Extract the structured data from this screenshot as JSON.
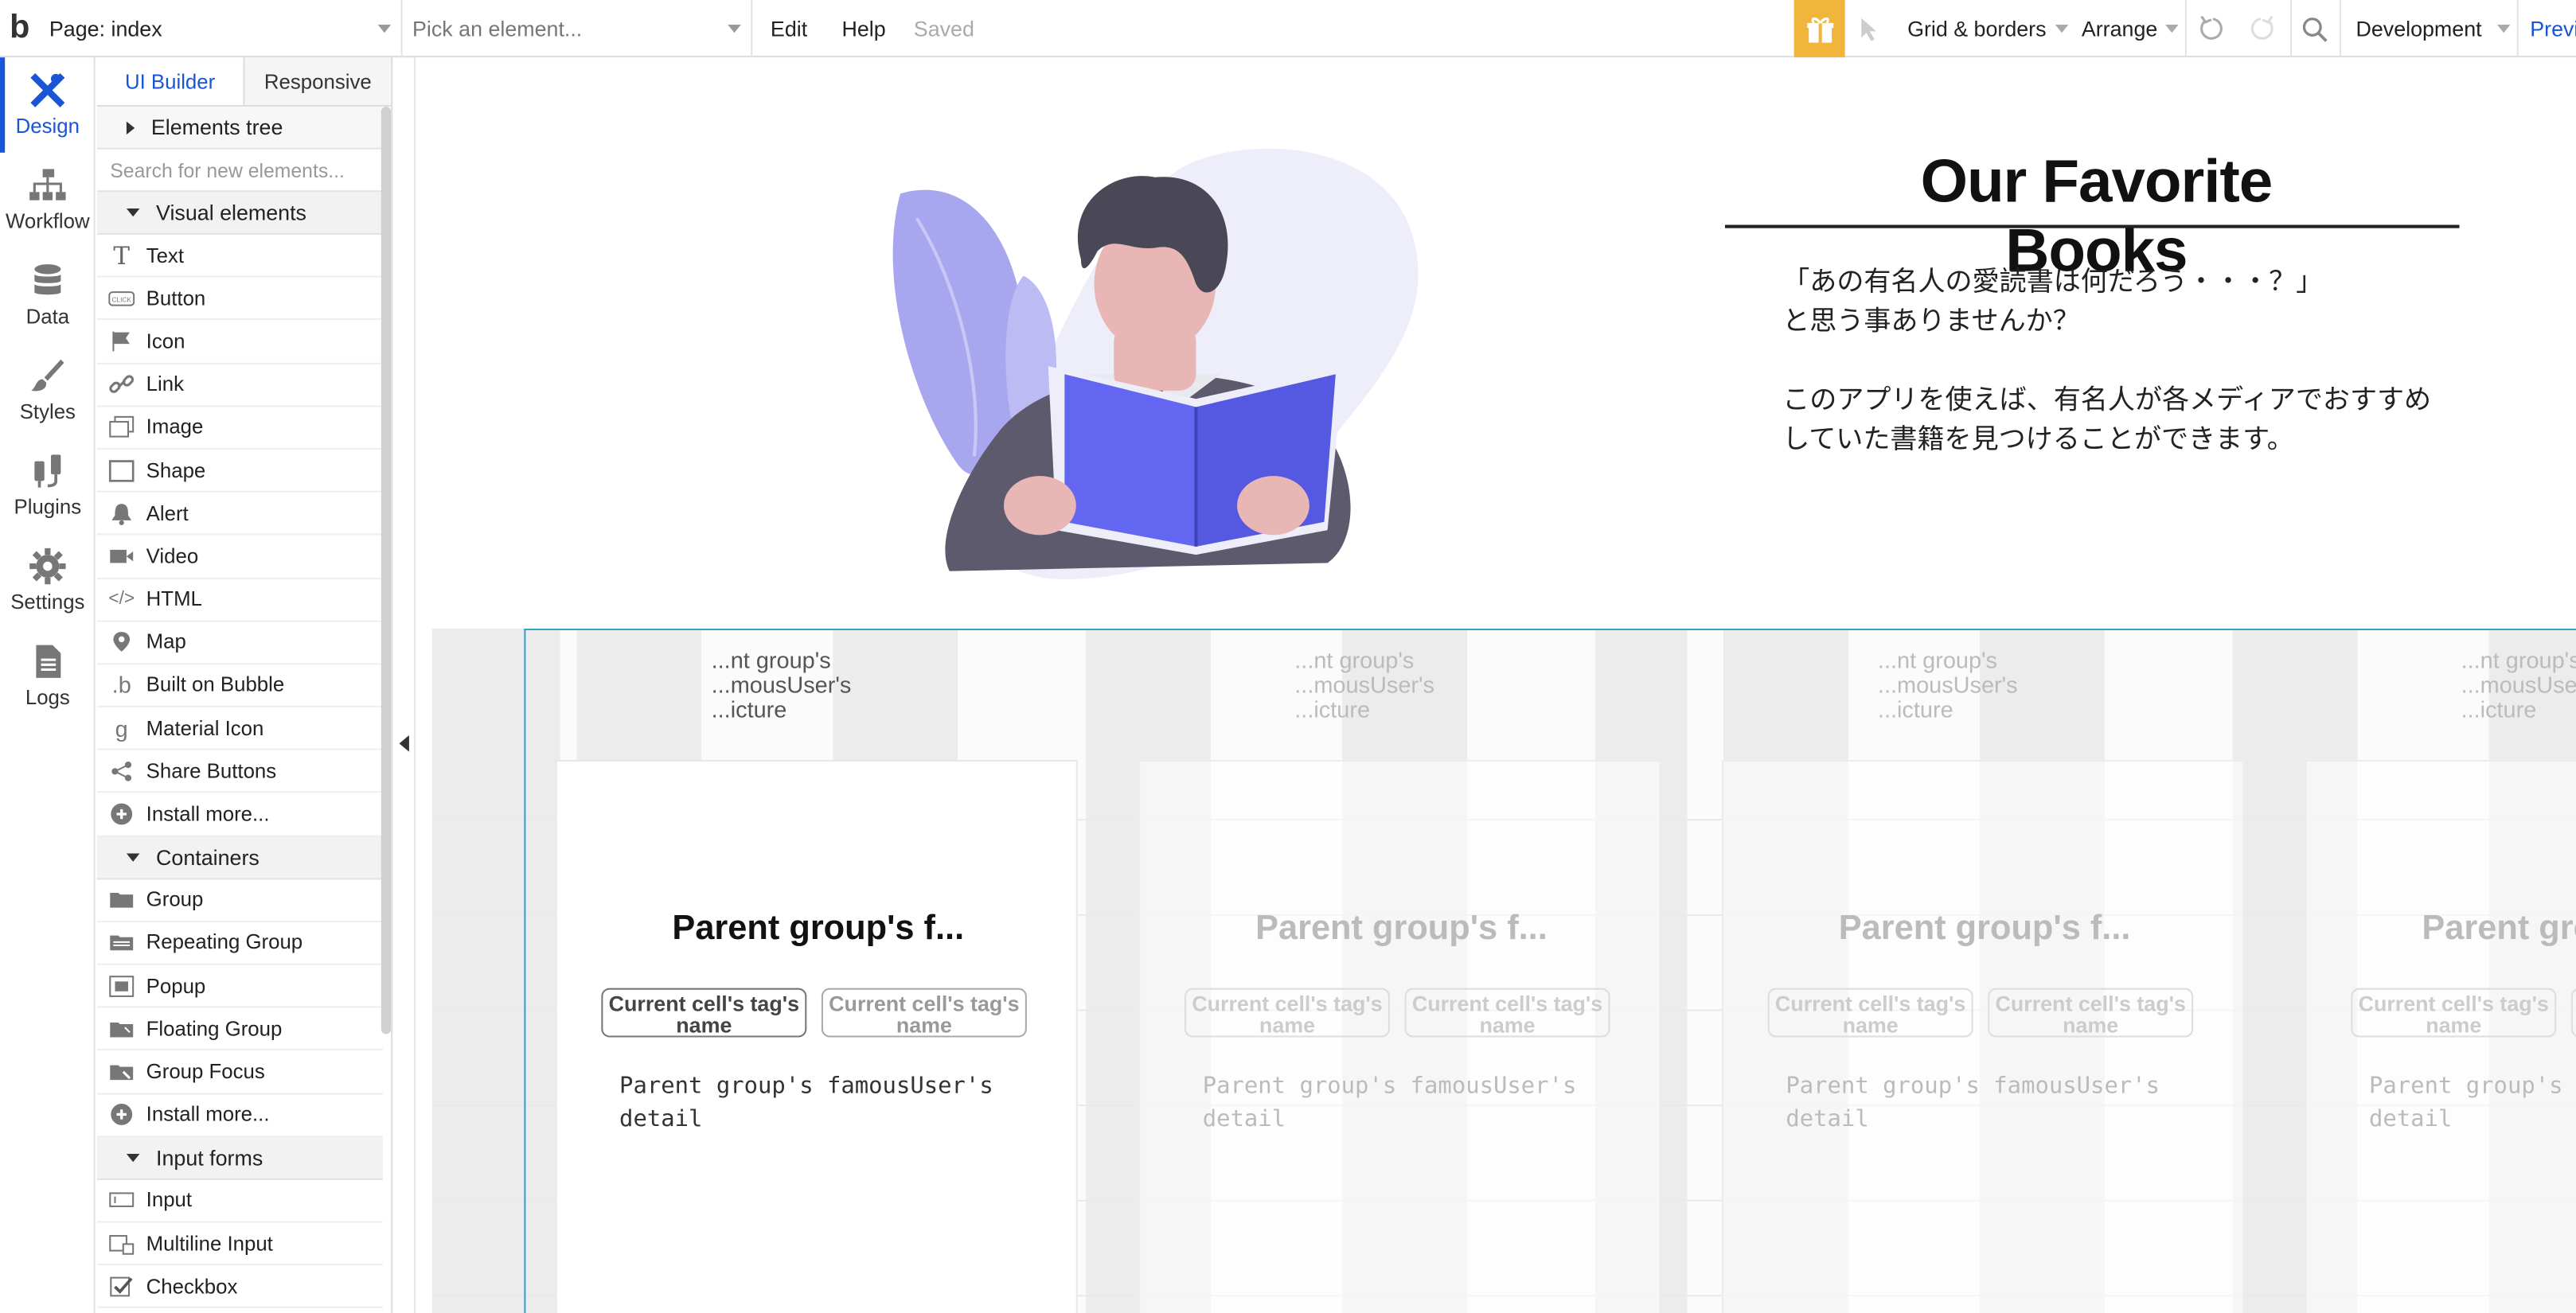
{
  "topbar": {
    "logo": "b",
    "page_select": "Page: index",
    "element_select": "Pick an element...",
    "edit": "Edit",
    "help": "Help",
    "saved": "Saved",
    "grid_borders": "Grid & borders",
    "arrange": "Arrange",
    "environment": "Development",
    "preview": "Previ"
  },
  "leftnav": {
    "items": [
      {
        "label": "Design",
        "icon": "design-icon",
        "active": true
      },
      {
        "label": "Workflow",
        "icon": "workflow-icon"
      },
      {
        "label": "Data",
        "icon": "database-icon"
      },
      {
        "label": "Styles",
        "icon": "brush-icon"
      },
      {
        "label": "Plugins",
        "icon": "plug-icon"
      },
      {
        "label": "Settings",
        "icon": "gear-icon"
      },
      {
        "label": "Logs",
        "icon": "document-icon"
      }
    ]
  },
  "palette": {
    "tabs": [
      "UI Builder",
      "Responsive"
    ],
    "elements_tree": "Elements tree",
    "search_placeholder": "Search for new elements...",
    "visual_section": "Visual elements",
    "visual_items": [
      "Text",
      "Button",
      "Icon",
      "Link",
      "Image",
      "Shape",
      "Alert",
      "Video",
      "HTML",
      "Map",
      "Built on Bubble",
      "Material Icon",
      "Share Buttons",
      "Install more..."
    ],
    "containers_section": "Containers",
    "container_items": [
      "Group",
      "Repeating Group",
      "Popup",
      "Floating Group",
      "Group Focus",
      "Install more..."
    ],
    "input_section": "Input forms",
    "input_items": [
      "Input",
      "Multiline Input",
      "Checkbox"
    ]
  },
  "canvas": {
    "hero_title": "Our Favorite Books",
    "hero_text_1": "「あの有名人の愛読書は何だろう・・・？」",
    "hero_text_2": "と思う事ありませんか？",
    "hero_text_3": "このアプリを使えば、有名人が各メディアでおすすめ",
    "hero_text_4": "していた書籍を見つけることができます。",
    "pic_label": "...nt group's\n...mousUser's\n...icture",
    "card_title": "Parent group's f...",
    "tag_label": "Current cell's tag's name",
    "card_detail": "Parent group's famousUser's detail"
  },
  "colors": {
    "accent": "#1a55d6",
    "gift": "#f0b53a",
    "book": "#6366f1",
    "leaf": "#a9a6f0"
  }
}
